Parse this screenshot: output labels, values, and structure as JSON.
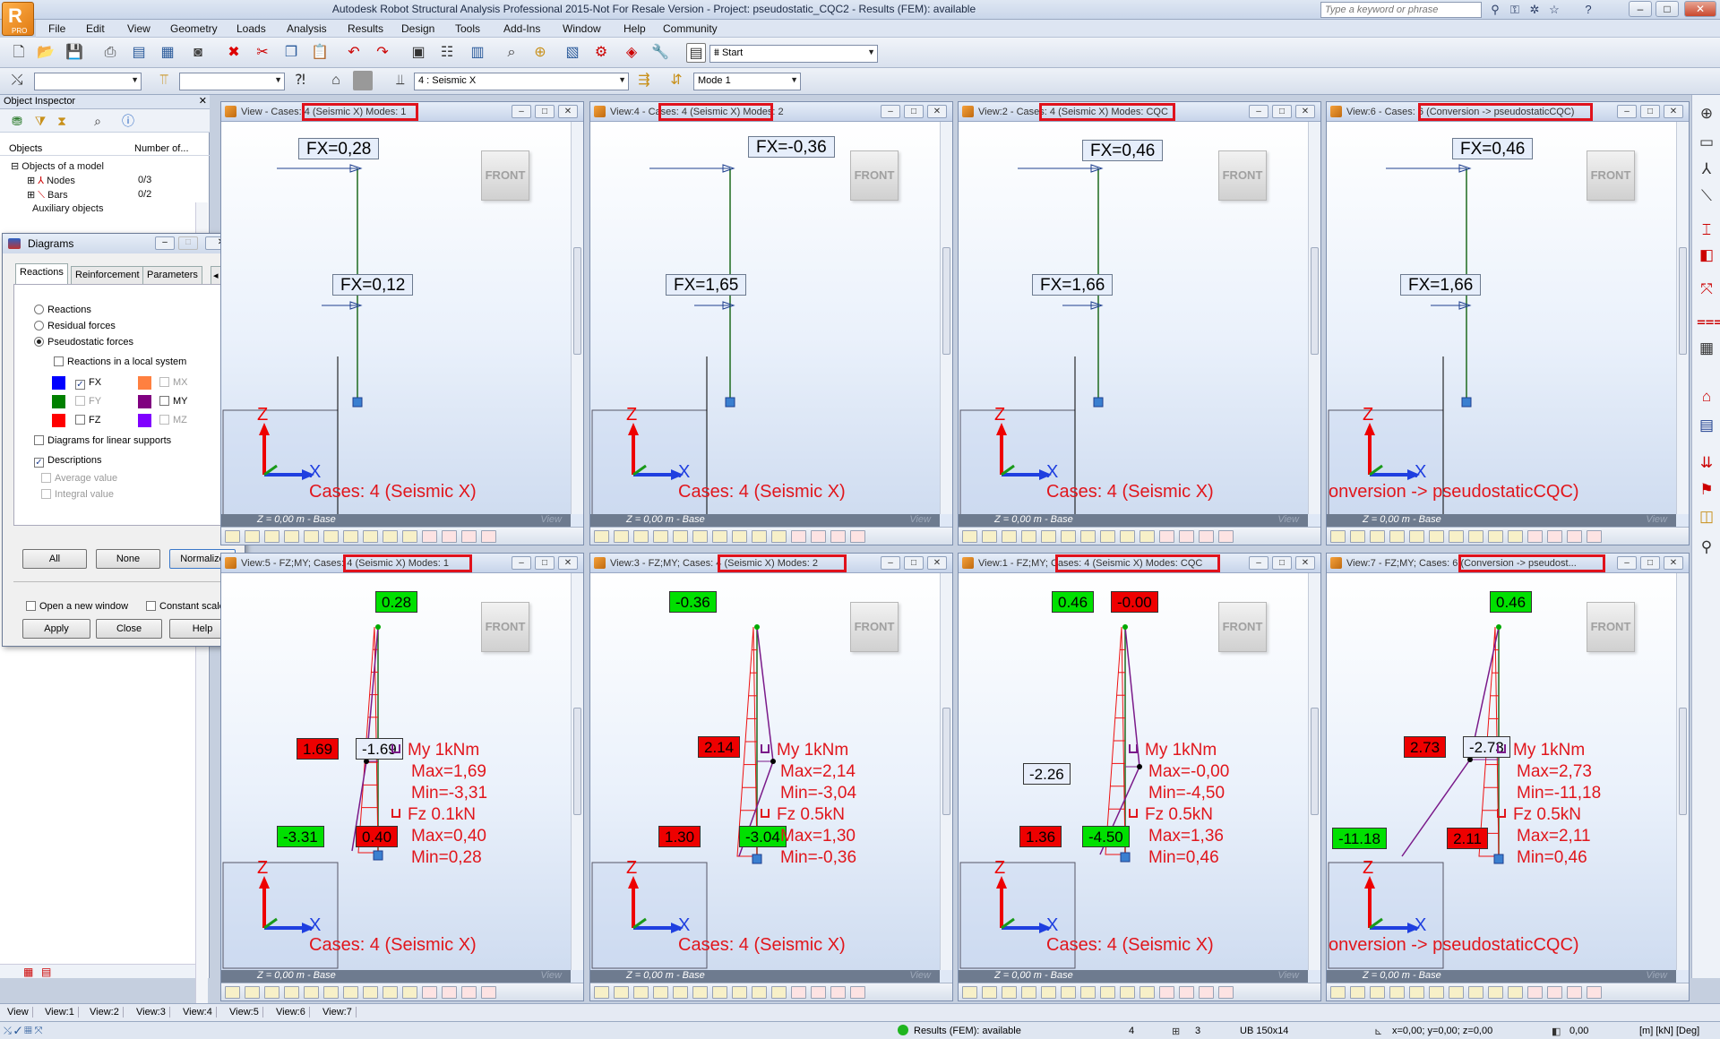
{
  "window": {
    "title": "Autodesk Robot Structural Analysis Professional 2015-Not For Resale Version - Project: pseudostatic_CQC2 - Results (FEM): available",
    "search_placeholder": "Type a keyword or phrase",
    "logo_text": "PRO",
    "minimize": "–",
    "maximize": "□",
    "close": "✕"
  },
  "menu": [
    "File",
    "Edit",
    "View",
    "Geometry",
    "Loads",
    "Analysis",
    "Results",
    "Design",
    "Tools",
    "Add-Ins",
    "Window",
    "Help",
    "Community"
  ],
  "toolbar": {
    "start_combo": "Start",
    "case_combo": "4 : Seismic X",
    "mode_combo": "Mode  1"
  },
  "inspector": {
    "title": "Object Inspector",
    "col_objects": "Objects",
    "col_number": "Number of...",
    "tree_root": "Objects of a model",
    "nodes_label": "Nodes",
    "nodes_count": "0/3",
    "bars_label": "Bars",
    "bars_count": "0/2",
    "auxiliary": "Auxiliary objects"
  },
  "diagrams": {
    "title": "Diagrams",
    "tabs": [
      "Reactions",
      "Reinforcement",
      "Parameters"
    ],
    "radio_reactions": "Reactions",
    "radio_residual": "Residual forces",
    "radio_pseudostatic": "Pseudostatic forces",
    "local_system": "Reactions in a local system",
    "fx": "FX",
    "fy": "FY",
    "fz": "FZ",
    "mx": "MX",
    "my": "MY",
    "mz": "MZ",
    "linear_supports": "Diagrams for linear supports",
    "descriptions": "Descriptions",
    "average_value": "Average value",
    "integral_value": "Integral value",
    "btn_all": "All",
    "btn_none": "None",
    "btn_normalize": "Normalize",
    "open_new_window": "Open a new window",
    "constant_scale": "Constant scale",
    "btn_apply": "Apply",
    "btn_close": "Close",
    "btn_help": "Help",
    "colors": {
      "fx": "#0000ff",
      "fy": "#008000",
      "fz": "#ff0000",
      "mx": "#ff8040",
      "my": "#800080",
      "mz": "#8000ff"
    }
  },
  "views_top": [
    {
      "title_pre": "View - Cases: ",
      "title_hl": "4 (Seismic X) Modes: 1",
      "fx_top": "FX=0,28",
      "fx_mid": "FX=0,12",
      "case": "Cases: 4 (Seismic X)"
    },
    {
      "title_pre": "View:4 - Cases: ",
      "title_hl": "4 (Seismic X) Modes: 2",
      "fx_top": "FX=-0,36",
      "fx_mid": "FX=1,65",
      "case": "Cases: 4 (Seismic X)"
    },
    {
      "title_pre": "View:2 - Cases: ",
      "title_hl": "4 (Seismic X) Modes: CQC",
      "fx_top": "FX=0,46",
      "fx_mid": "FX=1,66",
      "case": "Cases: 4 (Seismic X)"
    },
    {
      "title_pre": "View:6 - Cases: ",
      "title_hl": "6 (Conversion -> pseudostaticCQC)",
      "fx_top": "FX=0,46",
      "fx_mid": "FX=1,66",
      "case": "onversion -> pseudostaticCQC)"
    }
  ],
  "views_bottom": [
    {
      "title_pre": "View:5 - FZ;MY; Cases: ",
      "title_hl": "4 (Seismic X) Modes: 1",
      "top_g": "0.28",
      "top_r": "",
      "mid_r": "1.69",
      "mid_w": "-1.69",
      "bot_g": "-3.31",
      "bot_r": "0.40",
      "my": "My  1kNm",
      "my_max": "Max=1,69",
      "my_min": "Min=-3,31",
      "fz": "Fz  0.1kN",
      "fz_max": "Max=0,40",
      "fz_min": "Min=0,28",
      "case": "Cases: 4 (Seismic X)"
    },
    {
      "title_pre": "View:3 - FZ;MY; Cases: ",
      "title_hl": "4 (Seismic X) Modes: 2",
      "top_g": "-0.36",
      "top_r": "",
      "mid_r": "2.14",
      "mid_w": "",
      "bot_g": "-3.04",
      "bot_r": "1.30",
      "my": "My  1kNm",
      "my_max": "Max=2,14",
      "my_min": "Min=-3,04",
      "fz": "Fz  0.5kN",
      "fz_max": "Max=1,30",
      "fz_min": "Min=-0,36",
      "case": "Cases: 4 (Seismic X)"
    },
    {
      "title_pre": "View:1 - FZ;MY; ",
      "title_hl": "Cases: 4 (Seismic X) Modes: CQC",
      "top_g": "0.46",
      "top_r": "-0.00",
      "mid_r": "",
      "mid_w": "-2.26",
      "bot_g": "-4.50",
      "bot_r": "1.36",
      "my": "My  1kNm",
      "my_max": "Max=-0,00",
      "my_min": "Min=-4,50",
      "fz": "Fz  0.5kN",
      "fz_max": "Max=1,36",
      "fz_min": "Min=0,46",
      "case": "Cases: 4 (Seismic X)"
    },
    {
      "title_pre": "View:7 - FZ;MY; Cases: ",
      "title_hl": "6 (Conversion -> pseudost...",
      "top_g": "0.46",
      "top_r": "",
      "mid_r": "2.73",
      "mid_w": "-2.73",
      "bot_g": "-11.18",
      "bot_r": "2.11",
      "my": "My  1kNm",
      "my_max": "Max=2,73",
      "my_min": "Min=-11,18",
      "fz": "Fz  0.5kN",
      "fz_max": "Max=2,11",
      "fz_min": "Min=0,46",
      "case": "onversion -> pseudostaticCQC)"
    }
  ],
  "view_common": {
    "front": "FRONT",
    "status": "Z = 0,00 m - Base",
    "view_word": "View",
    "axis_z": "Z",
    "axis_x": "X"
  },
  "view_tabs": [
    "View",
    "View:1",
    "View:2",
    "View:3",
    "View:4",
    "View:5",
    "View:6",
    "View:7"
  ],
  "status": {
    "results": "Results (FEM): available",
    "n1": "4",
    "n2": "3",
    "section": "UB 150x14",
    "coords": "x=0,00; y=0,00; z=0,00",
    "angle": "0,00",
    "units": "[m] [kN] [Deg]"
  }
}
